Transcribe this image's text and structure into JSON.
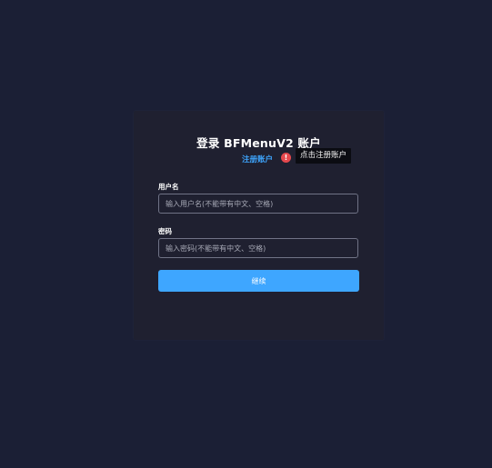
{
  "login": {
    "title": "登录 BFMenuV2 账户",
    "register_link": "注册账户",
    "alert_symbol": "!",
    "tooltip": "点击注册账户",
    "username_label": "用户名",
    "username_placeholder": "输入用户名(不能带有中文、空格)",
    "password_label": "密码",
    "password_placeholder": "输入密码(不能带有中文、空格)",
    "continue_label": "继续"
  },
  "colors": {
    "background": "#1b1f35",
    "card": "#1f2030",
    "accent": "#3ea6ff",
    "alert": "#e5484d",
    "tooltip_bg": "#0b0c12"
  },
  "icons": {
    "alert": "exclamation-circle-icon"
  }
}
